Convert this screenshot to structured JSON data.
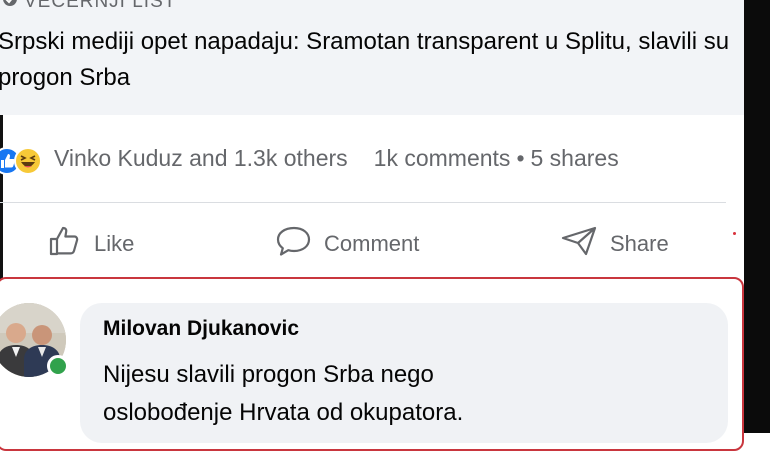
{
  "post": {
    "source": "VEČERNJI LIST",
    "headline": "Srpski mediji opet napadaju: Sramotan transparent u Splitu, slavili su progon Srba"
  },
  "reactions": {
    "names": "Vinko Kuduz and 1.3k others",
    "comments": "1k comments",
    "separator": "•",
    "shares": "5 shares",
    "icons": [
      "like-icon",
      "haha-icon"
    ]
  },
  "actions": {
    "like": "Like",
    "comment": "Comment",
    "share": "Share"
  },
  "comment": {
    "author": "Milovan Djukanovic",
    "line1": "Nijesu slavili progon Srba nego",
    "line2": "oslobođenje Hrvata od okupatora."
  },
  "colors": {
    "highlight_border": "#c9363e",
    "link_preview_bg": "#f2f4f7",
    "bubble_bg": "#f0f2f5",
    "like_blue": "#1877f2",
    "online_green": "#31a24c"
  }
}
